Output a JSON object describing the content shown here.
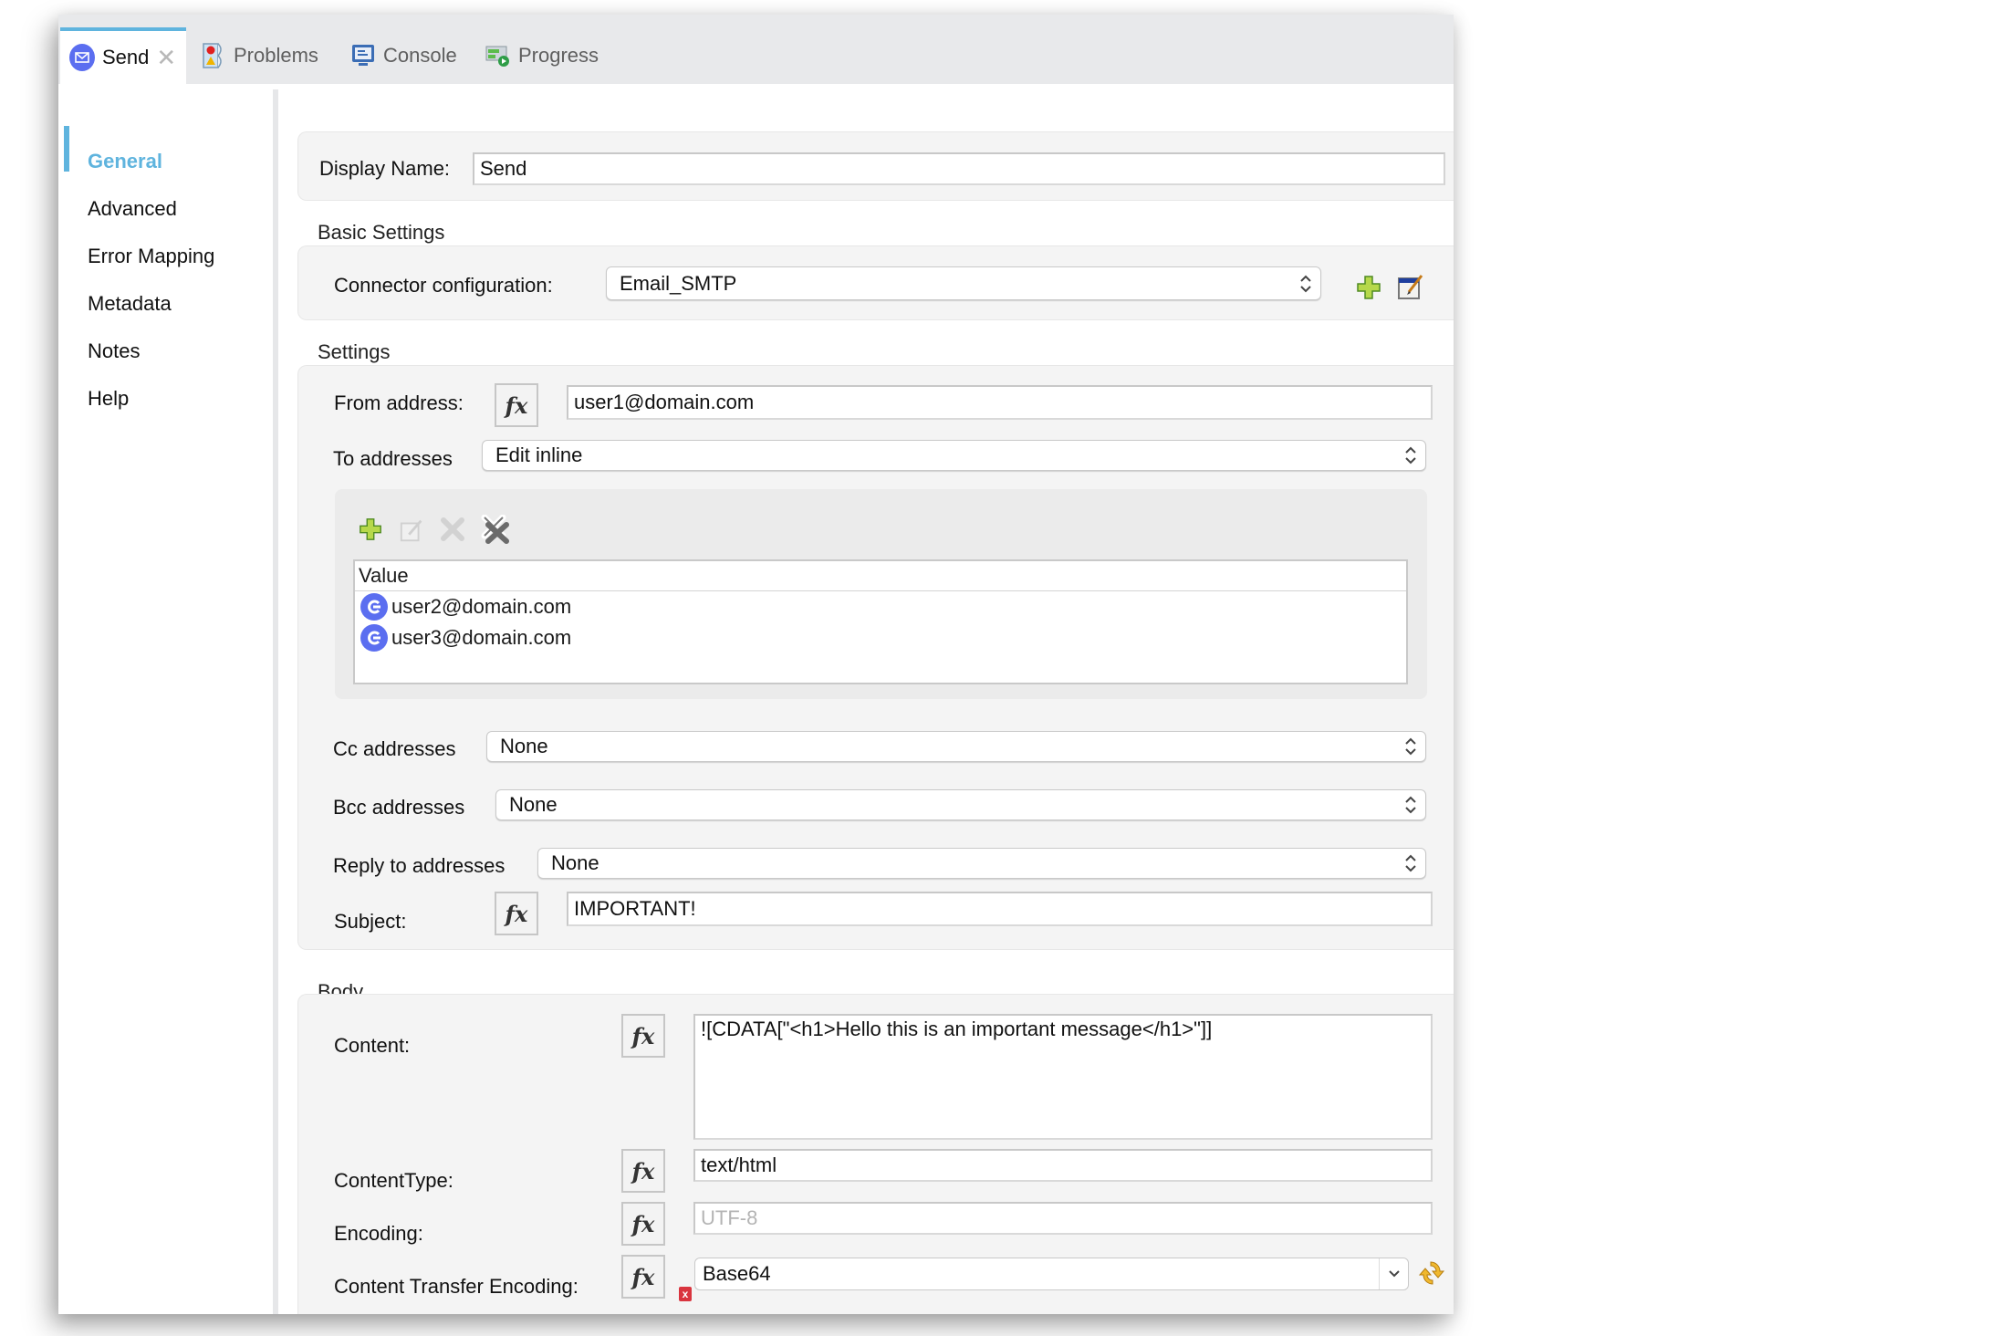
{
  "tabs": [
    {
      "label": "Send",
      "icon": "email-send-icon",
      "active": true,
      "closable": true
    },
    {
      "label": "Problems",
      "icon": "problems-icon"
    },
    {
      "label": "Console",
      "icon": "console-icon"
    },
    {
      "label": "Progress",
      "icon": "progress-icon"
    }
  ],
  "sidebar": {
    "items": [
      {
        "label": "General",
        "active": true
      },
      {
        "label": "Advanced"
      },
      {
        "label": "Error Mapping"
      },
      {
        "label": "Metadata"
      },
      {
        "label": "Notes"
      },
      {
        "label": "Help"
      }
    ]
  },
  "display_name": {
    "label": "Display Name:",
    "value": "Send"
  },
  "basic_settings": {
    "title": "Basic Settings",
    "connector_label": "Connector configuration:",
    "connector_value": "Email_SMTP"
  },
  "settings": {
    "title": "Settings",
    "from_label": "From address:",
    "from_value": "user1@domain.com",
    "to_label": "To addresses",
    "to_mode": "Edit inline",
    "to_table": {
      "column": "Value",
      "rows": [
        "user2@domain.com",
        "user3@domain.com"
      ]
    },
    "cc_label": "Cc addresses",
    "cc_value": "None",
    "bcc_label": "Bcc addresses",
    "bcc_value": "None",
    "reply_label": "Reply to addresses",
    "reply_value": "None",
    "subject_label": "Subject:",
    "subject_value": "IMPORTANT!"
  },
  "body": {
    "title": "Body",
    "content_label": "Content:",
    "content_value": "![CDATA[\"<h1>Hello this is an important message</h1>\"]]",
    "content_type_label": "ContentType:",
    "content_type_value": "text/html",
    "encoding_label": "Encoding:",
    "encoding_placeholder": "UTF-8",
    "cte_label": "Content Transfer Encoding:",
    "cte_value": "Base64"
  },
  "fx_label": "fx",
  "error_badge": "x",
  "colors": {
    "accent": "#5fb4de",
    "connector_icon": "#5b6ef0",
    "error": "#d9343e"
  }
}
